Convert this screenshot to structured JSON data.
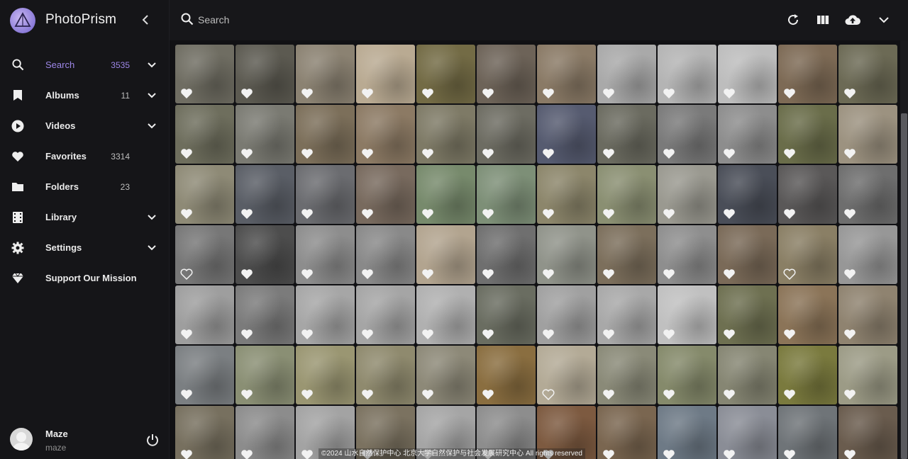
{
  "app": {
    "title": "PhotoPrism"
  },
  "nav": [
    {
      "name": "nav-item-search",
      "icon": "search-icon",
      "label": "Search",
      "count": "3535",
      "expand": true,
      "active": true
    },
    {
      "name": "nav-item-albums",
      "icon": "bookmark-icon",
      "label": "Albums",
      "count": "11",
      "expand": true,
      "active": false
    },
    {
      "name": "nav-item-videos",
      "icon": "play-circle-icon",
      "label": "Videos",
      "count": "",
      "expand": true,
      "active": false
    },
    {
      "name": "nav-item-favorites",
      "icon": "heart-icon",
      "label": "Favorites",
      "count": "3314",
      "expand": false,
      "active": false
    },
    {
      "name": "nav-item-folders",
      "icon": "folder-icon",
      "label": "Folders",
      "count": "23",
      "expand": false,
      "active": false
    },
    {
      "name": "nav-item-library",
      "icon": "film-icon",
      "label": "Library",
      "count": "",
      "expand": true,
      "active": false
    },
    {
      "name": "nav-item-settings",
      "icon": "gear-icon",
      "label": "Settings",
      "count": "",
      "expand": true,
      "active": false
    },
    {
      "name": "nav-item-support",
      "icon": "diamond-icon",
      "label": "Support Our Mission",
      "count": "",
      "expand": false,
      "active": false
    }
  ],
  "user": {
    "name": "Maze",
    "login": "maze"
  },
  "search": {
    "placeholder": "Search"
  },
  "toolbar": {
    "icons": [
      "refresh-icon",
      "view-columns-icon",
      "cloud-upload-icon",
      "chevron-down-icon"
    ]
  },
  "photos": {
    "rows": 7,
    "cols": 12,
    "tile_colors": [
      "#6f6d62",
      "#5c5a51",
      "#8b8272",
      "#b9aa92",
      "#736b45",
      "#6d6358",
      "#8a7a66",
      "#a9a9a9",
      "#b4b4b4",
      "#bdbdbd",
      "#7d6a55",
      "#6c6a55",
      "#6e6e5d",
      "#7a7a72",
      "#7c6f5a",
      "#8c7a64",
      "#7e7a66",
      "#6d6c62",
      "#565b70",
      "#6b6b60",
      "#7a7a7a",
      "#8d8d8d",
      "#6a6d4a",
      "#9c9280",
      "#8e8a76",
      "#5a5e66",
      "#6b6c70",
      "#786a5e",
      "#778a6c",
      "#7d8f77",
      "#8c866b",
      "#8a8f72",
      "#9a9990",
      "#4a4e58",
      "#5a5858",
      "#6e6e6e",
      "#777777",
      "#4d4d4d",
      "#8d8d8d",
      "#898989",
      "#b2a48f",
      "#6f6f6f",
      "#90938a",
      "#7c6f5c",
      "#8e8e8e",
      "#7a6a58",
      "#8a7f65",
      "#979797",
      "#9e9e9e",
      "#7b7b7b",
      "#a6a6a6",
      "#a5a5a5",
      "#b0b0b0",
      "#6a6d61",
      "#a0a0a0",
      "#a8a8a8",
      "#c0c0c0",
      "#6e7051",
      "#8b7458",
      "#8f8370",
      "#7b7f82",
      "#8a8f74",
      "#9a9672",
      "#8f8a6e",
      "#8d8978",
      "#8a6e40",
      "#b3aa96",
      "#8a8a78",
      "#858a6b",
      "#868673",
      "#7a7a3e",
      "#9c9b86",
      "#77705f",
      "#8c8c8c",
      "#a3a3a3",
      "#7b7260",
      "#a5a5a5",
      "#8d8d8d",
      "#7d5a40",
      "#7a6650",
      "#6e7a86",
      "#8a8d96",
      "#6f7478",
      "#6a5c4e"
    ],
    "favorite_flags": [
      true,
      true,
      true,
      true,
      true,
      true,
      true,
      true,
      true,
      true,
      true,
      true,
      true,
      true,
      true,
      true,
      true,
      true,
      true,
      true,
      true,
      true,
      true,
      true,
      true,
      true,
      true,
      true,
      true,
      true,
      true,
      true,
      true,
      true,
      true,
      true,
      false,
      true,
      true,
      true,
      true,
      true,
      true,
      true,
      true,
      true,
      false,
      true,
      true,
      true,
      true,
      true,
      true,
      true,
      true,
      true,
      true,
      true,
      true,
      true,
      true,
      true,
      true,
      true,
      true,
      true,
      false,
      true,
      true,
      true,
      true,
      true,
      true,
      true,
      true,
      true,
      true,
      true,
      true,
      true,
      true,
      true,
      true,
      true
    ]
  },
  "watermark": "©2024 山水自然保护中心  北京大学自然保护与社会发展研究中心  All rights reserved",
  "colors": {
    "accent": "#9d87e8",
    "sidebar_bg": "#151518",
    "topbar_bg": "#17171a",
    "page_bg": "#111114"
  }
}
